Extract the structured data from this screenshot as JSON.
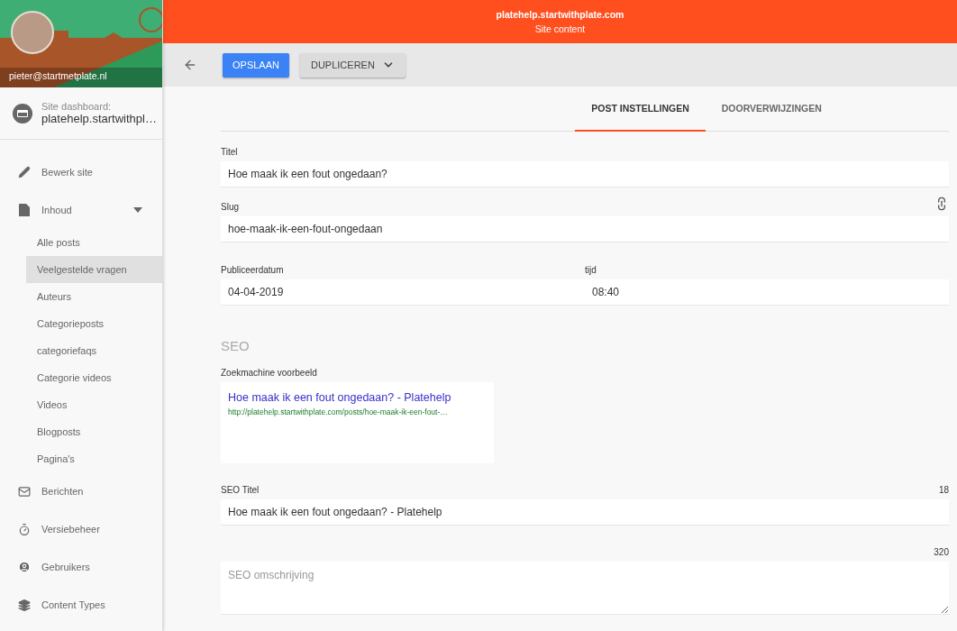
{
  "header": {
    "site": "platehelp.startwithplate.com",
    "subtitle": "Site content"
  },
  "sidebar": {
    "user_email": "pieter@startmetplate.nl",
    "dashboard_label": "Site dashboard:",
    "dashboard_site": "platehelp.startwithpl…",
    "items": [
      {
        "label": "Bewerk site"
      },
      {
        "label": "Inhoud",
        "expanded": true,
        "children": [
          {
            "label": "Alle posts",
            "selected": false
          },
          {
            "label": "Veelgestelde vragen",
            "selected": true
          },
          {
            "label": "Auteurs",
            "selected": false
          },
          {
            "label": "Categorieposts",
            "selected": false
          },
          {
            "label": "categoriefaqs",
            "selected": false
          },
          {
            "label": "Categorie videos",
            "selected": false
          },
          {
            "label": "Videos",
            "selected": false
          },
          {
            "label": "Blogposts",
            "selected": false
          },
          {
            "label": "Pagina's",
            "selected": false
          }
        ]
      },
      {
        "label": "Berichten"
      },
      {
        "label": "Versiebeheer"
      },
      {
        "label": "Gebruikers"
      },
      {
        "label": "Content Types"
      }
    ]
  },
  "toolbar": {
    "save": "OPSLAAN",
    "duplicate": "DUPLICEREN"
  },
  "tabs": [
    {
      "label": "POST INSTELLINGEN",
      "selected": true
    },
    {
      "label": "DOORVERWIJZINGEN",
      "selected": false
    }
  ],
  "form": {
    "title_label": "Titel",
    "title": "Hoe maak ik een fout ongedaan?",
    "slug_label": "Slug",
    "slug": "hoe-maak-ik-een-fout-ongedaan",
    "date_label": "Publiceerdatum",
    "date": "04-04-2019",
    "time_label": "tijd",
    "time": "08:40"
  },
  "seo": {
    "heading": "SEO",
    "preview_label": "Zoekmachine voorbeeld",
    "preview_title": "Hoe maak ik een fout ongedaan? - Platehelp",
    "preview_url": "http://platehelp.startwithplate.com/posts/hoe-maak-ik-een-fout-…",
    "title_label": "SEO Titel",
    "title_count": "18",
    "title": "Hoe maak ik een fout ongedaan? - Platehelp",
    "description_count": "320",
    "description_placeholder": "SEO omschrijving"
  }
}
